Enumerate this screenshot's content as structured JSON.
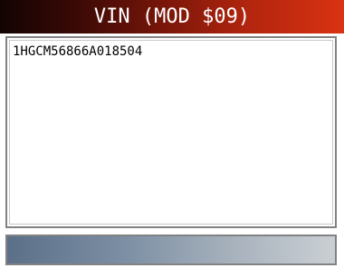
{
  "header": {
    "title": "VIN (MOD $09)"
  },
  "content": {
    "vin": "1HGCM56866A018504"
  },
  "colors": {
    "title_gradient_start": "#120404",
    "title_gradient_end": "#d93212",
    "status_gradient_start": "#5b6f88",
    "status_gradient_end": "#cacfd4",
    "frame_border": "#828282"
  }
}
